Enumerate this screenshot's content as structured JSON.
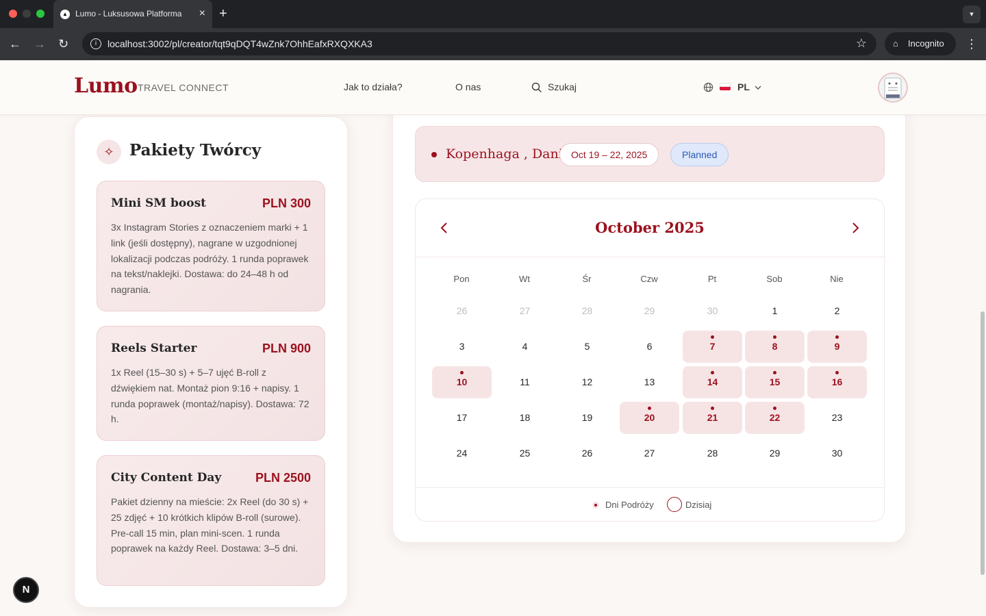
{
  "browser": {
    "tab_title": "Lumo - Luksusowa Platforma",
    "url": "localhost:3002/pl/creator/tqt9qDQT4wZnk7OhhEafxRXQXKA3",
    "incognito_label": "Incognito"
  },
  "header": {
    "logo": "Lumo",
    "logo_sub": "TRAVEL CONNECT",
    "nav": [
      "Jak to działa?",
      "O nas"
    ],
    "search_label": "Szukaj",
    "lang": "PL"
  },
  "packages": {
    "title": "Pakiety Twórcy",
    "items": [
      {
        "name": "Mini SM boost",
        "price": "PLN 300",
        "desc": "3x Instagram Stories z oznaczeniem marki + 1 link (jeśli dostępny), nagrane w uzgodnionej lokalizacji podczas podróży. 1 runda poprawek na tekst/naklejki. Dostawa: do 24–48 h od nagrania."
      },
      {
        "name": "Reels Starter",
        "price": "PLN 900",
        "desc": "1x Reel (15–30 s) + 5–7 ujęć B-roll z dźwiękiem nat. Montaż pion 9:16 + napisy. 1 runda poprawek (montaż/napisy). Dostawa: 72 h."
      },
      {
        "name": "City Content Day",
        "price": "PLN 2500",
        "desc": "Pakiet dzienny na mieście: 2x Reel (do 30 s) + 25 zdjęć + 10 krótkich klipów B-roll (surowe). Pre-call 15 min, plan mini-scen. 1 runda poprawek na każdy Reel. Dostawa: 3–5 dni."
      }
    ]
  },
  "trip": {
    "city": "Kopenhaga , Dania",
    "dates": "Oct 19 – 22, 2025",
    "status": "Planned"
  },
  "calendar": {
    "month": "October 2025",
    "weekdays": [
      "Pon",
      "Wt",
      "Śr",
      "Czw",
      "Pt",
      "Sob",
      "Nie"
    ],
    "weeks": [
      [
        "26",
        "27",
        "28",
        "29",
        "30",
        "1",
        "2"
      ],
      [
        "3",
        "4",
        "5",
        "6",
        "7",
        "8",
        "9"
      ],
      [
        "10",
        "11",
        "12",
        "13",
        "14",
        "15",
        "16"
      ],
      [
        "17",
        "18",
        "19",
        "20",
        "21",
        "22",
        "23"
      ],
      [
        "24",
        "25",
        "26",
        "27",
        "28",
        "29",
        "30"
      ]
    ],
    "muted": [
      [
        0,
        0
      ],
      [
        0,
        1
      ],
      [
        0,
        2
      ],
      [
        0,
        3
      ],
      [
        0,
        4
      ]
    ],
    "trip_days": [
      [
        1,
        4
      ],
      [
        1,
        5
      ],
      [
        1,
        6
      ],
      [
        2,
        0
      ],
      [
        2,
        4
      ],
      [
        2,
        5
      ],
      [
        2,
        6
      ],
      [
        3,
        3
      ],
      [
        3,
        4
      ],
      [
        3,
        5
      ]
    ],
    "legend_trip": "Dni Podróży",
    "legend_today": "Dzisiaj"
  },
  "colors": {
    "accent": "#9b111e",
    "trip_bg": "#f6e4e5",
    "status_blue": "#dfe9fb"
  }
}
